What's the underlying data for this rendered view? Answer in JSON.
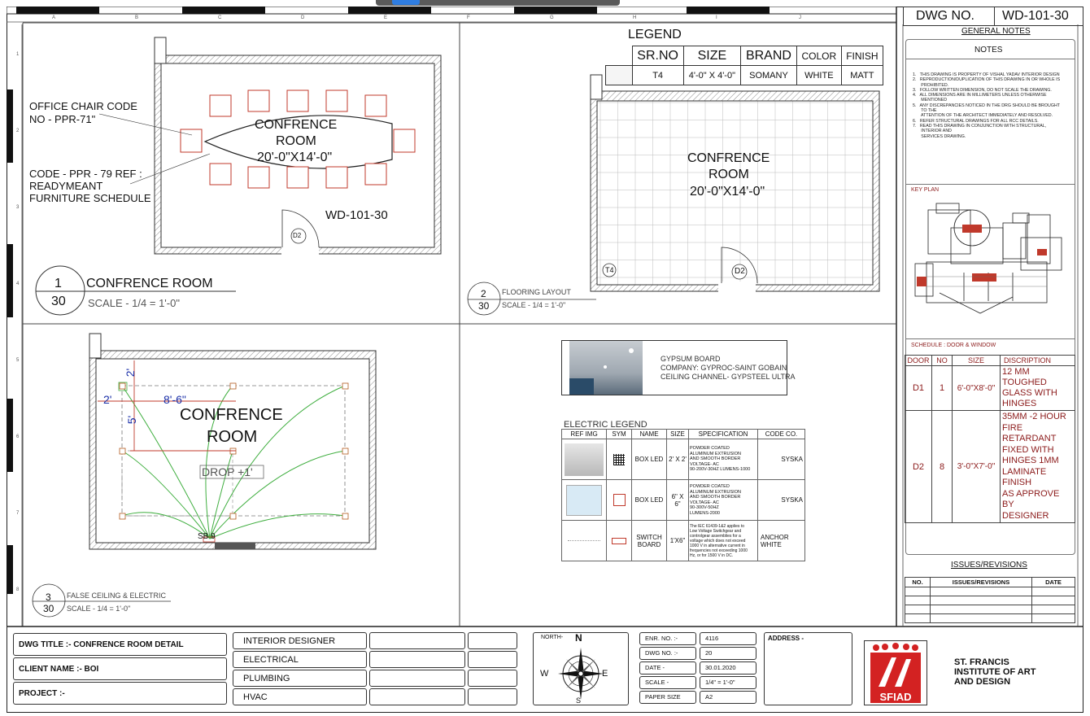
{
  "sheet": {
    "grid_letters": [
      "A",
      "B",
      "C",
      "D",
      "E",
      "F",
      "G",
      "H",
      "I",
      "J"
    ],
    "grid_numbers": [
      "1",
      "2",
      "3",
      "4",
      "5",
      "6",
      "7",
      "8"
    ]
  },
  "header": {
    "dwg_no_label": "DWG NO.",
    "dwg_no_value": "WD-101-30"
  },
  "general_notes": {
    "title": "GENERAL NOTES",
    "notes_label": "NOTES",
    "items": [
      "1.   THIS DRAWING IS PROPERTY OF VISHAL YADAV INTERIOR DESIGN",
      "2.   REPRODUCTION/DUPLICATION OF THIS DRAWING IN OR WHOLE IS",
      "       PROHIBITED.",
      "3.   FOLLOW WRITTEN DIMENSION, DO NOT SCALE THE DRAWING.",
      "4.   ALL DIMENSIONS ARE IN MILLIMETERS UNLESS OTHERWISE",
      "       MENTIONED",
      "5.   ANY DISCREPANCIES NOTICED IN THE DRG SHOULD BE BROUGHT",
      "       TO THE",
      "       ATTENTION OF THE ARCHITECT IMMEDIATELY AND RESOLVED.",
      "6.   REFER STRUCTURAL DRAWINGS FOR ALL RCC DETAILS.",
      "7.   READ THIS DRAWING IN CONJUNCTION WITH STRUCTURAL,",
      "       INTERIOR AND",
      "       SERVICES DRAWING."
    ]
  },
  "key_plan": {
    "label": "KEY PLAN"
  },
  "door_schedule": {
    "title": "SCHEDULE :  DOOR & WINDOW",
    "headers": [
      "DOOR",
      "NO",
      "SIZE",
      "DISCRIPTION"
    ],
    "rows": [
      {
        "door": "D1",
        "no": "1",
        "size": "6'-0\"X8'-0\"",
        "desc": [
          "12 MM TOUGHED",
          "GLASS WITH",
          "HINGES"
        ]
      },
      {
        "door": "D2",
        "no": "8",
        "size": "3'-0\"X7'-0\"",
        "desc": [
          "35MM -2 HOUR",
          "FIRE RETARDANT",
          "FIXED WITH",
          "HINGES 1MM",
          "LAMINATE FINISH",
          "AS APPROVE BY",
          "DESIGNER"
        ]
      }
    ]
  },
  "revisions": {
    "title": "ISSUES/REVISIONS",
    "headers": [
      "NO.",
      "ISSUES/REVISIONS",
      "DATE"
    ]
  },
  "plan1": {
    "room_name_1": "CONFRENCE",
    "room_name_2": "ROOM",
    "room_size": "20'-0\"X14'-0\"",
    "chair_note_1": "OFFICE CHAIR CODE",
    "chair_note_2": "NO - PPR-71\"",
    "table_note_1": "CODE - PPR - 79 REF :",
    "table_note_2": "READYMEANT",
    "table_note_3": "FURNITURE SCHEDULE",
    "ref_code": "WD-101-30",
    "door_tag": "D2",
    "title_num": "1",
    "title_den": "30",
    "title": "CONFRENCE ROOM",
    "scale": "SCALE - 1/4 = 1'-0\""
  },
  "plan2": {
    "legend_title": "LEGEND",
    "legend_headers": [
      "SR.NO",
      "SIZE",
      "BRAND",
      "COLOR",
      "FINISH"
    ],
    "legend_row": [
      "T4",
      "4'-0\" X 4'-0\"",
      "SOMANY",
      "WHITE",
      "MATT"
    ],
    "room_name_1": "CONFRENCE",
    "room_name_2": "ROOM",
    "room_size": "20'-0\"X14'-0\"",
    "tile_tag": "T4",
    "door_tag": "D2",
    "title_num": "2",
    "title_den": "30",
    "title": "FLOORING LAYOUT",
    "scale": "SCALE - 1/4 = 1'-0\""
  },
  "plan3": {
    "room_name_1": "CONFRENCE",
    "room_name_2": "ROOM",
    "drop": "DROP +1'",
    "dim_2a": "2'",
    "dim_2b": "2'",
    "dim_86": "8'-6\"",
    "dim_5": "5'",
    "sb": "SB 9",
    "title_num": "3",
    "title_den": "30",
    "title": "FALSE CEILING & ELECTRIC",
    "scale": "SCALE - 1/4 = 1'-0\""
  },
  "gypsum": {
    "line1": "GYPSUM BOARD",
    "line2": "COMPANY: GYPROC-SAINT GOBAIN",
    "line3": "CEILING CHANNEL- GYPSTEEL ULTRA"
  },
  "electric_legend": {
    "title": "ELECTRIC LEGEND",
    "headers": [
      "REF IMG",
      "SYM",
      "NAME",
      "SIZE",
      "SPECIFICATION",
      "CODE  CO."
    ],
    "rows": [
      {
        "name": "BOX LED",
        "size": "2' X 2'",
        "spec": [
          "POWDER COATED",
          "ALUMINUM EXTRUSION",
          "AND SMOOTH BORDER",
          "VOLTAGE- AC",
          "90-200V-30HZ LUMENS-1000"
        ],
        "code": "SYSKA"
      },
      {
        "name": "BOX LED",
        "size": "6\" X 6\"",
        "spec": [
          "POWDER COATED",
          "ALUMINUM EXTRUSION",
          "AND SMOOTH BORDER",
          "VOLTAGE- AC",
          "90-300V-50HZ",
          "LUMENS-2000"
        ],
        "code": "SYSKA"
      },
      {
        "name": "SWITCH BOARD",
        "size": "1'X6\"",
        "spec": [
          "The IEC 61439-1&2 applies to",
          "Low Voltage Switchgear and",
          "controlgear assemblies for a",
          "voltage which does not exceed",
          "1000 V in alternative current in",
          "frequencies not exceeding 1000",
          "Hz, or for 1500 V in DC."
        ],
        "code": "ANCHOR WHITE"
      }
    ]
  },
  "title_block": {
    "dwg_title": "DWG TITLE :- CONFRENCE ROOM DETAIL",
    "client": "CLIENT NAME :- BOI",
    "project": "PROJECT :-",
    "consultants": [
      "INTERIOR DESIGNER",
      "ELECTRICAL",
      "PLUMBING",
      "HVAC"
    ],
    "north": "NORTH-",
    "compass": {
      "n": "N",
      "s": "S",
      "e": "E",
      "w": "W"
    },
    "info_labels": [
      "ENR. NO. :-",
      "DWG NO. :-",
      "DATE -",
      "SCALE -",
      "PAPER SIZE"
    ],
    "info_values": [
      "4116",
      "20",
      "30.01.2020",
      "1/4\" = 1'-0\"",
      "A2"
    ],
    "address": "ADDRESS -",
    "logo_text": "SFIAD",
    "institute": [
      "ST. FRANCIS",
      "INSTITUTE OF ART",
      "AND DESIGN"
    ]
  },
  "colors": {
    "accent_red": "#c0392b",
    "dim_blue": "#1a2fa8",
    "ceiling_green": "#3fae3f",
    "schedule_red": "#8b1a1a"
  }
}
